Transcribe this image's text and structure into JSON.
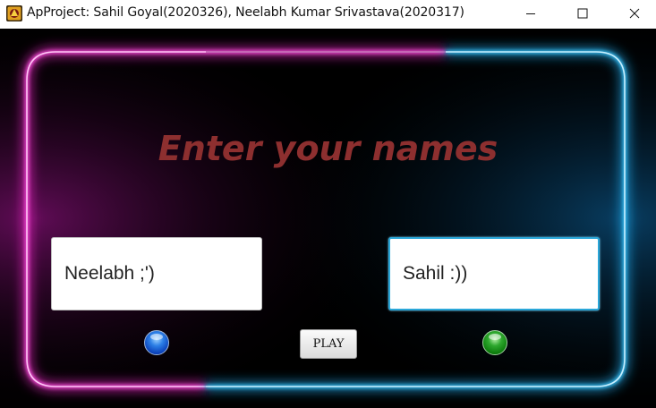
{
  "window": {
    "title": "ApProject: Sahil Goyal(2020326), Neelabh Kumar Srivastava(2020317)",
    "app_icon": "game-app-icon",
    "controls": [
      "minimize-icon",
      "maximize-icon",
      "close-icon"
    ]
  },
  "main": {
    "heading": "Enter your names",
    "player1": {
      "value": "Neelabh ;')",
      "token_color": "#1f6fe0",
      "token_icon": "blue-token-icon"
    },
    "player2": {
      "value": "Sahil :))",
      "token_color": "#1a9a1a",
      "token_icon": "green-token-icon"
    },
    "play_label": "PLAY"
  },
  "colors": {
    "background": "#000000",
    "heading": "#8d2f2f",
    "neon_pink": "#ff2bd6",
    "neon_blue": "#22b8ff",
    "focus_border": "#2aa7d9"
  }
}
